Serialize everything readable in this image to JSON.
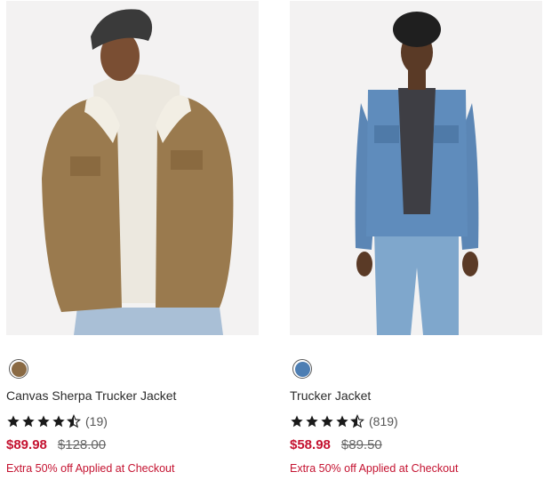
{
  "products": [
    {
      "name": "Canvas Sherpa Trucker Jacket",
      "swatch_color": "#8a6a44",
      "rating": 4.5,
      "rating_count": "(19)",
      "sale_price": "$89.98",
      "original_price": "$128.00",
      "promo": "Extra 50% off Applied at Checkout"
    },
    {
      "name": "Trucker Jacket",
      "swatch_color": "#4d7eb3",
      "rating": 4.5,
      "rating_count": "(819)",
      "sale_price": "$58.98",
      "original_price": "$89.50",
      "promo": "Extra 50% off Applied at Checkout"
    }
  ],
  "colors": {
    "sale_red": "#c41230",
    "star_black": "#1a1a1a",
    "photo_bg": "#f3f2f2"
  },
  "icons": [
    "star-icon",
    "half-star-icon",
    "color-swatch"
  ]
}
